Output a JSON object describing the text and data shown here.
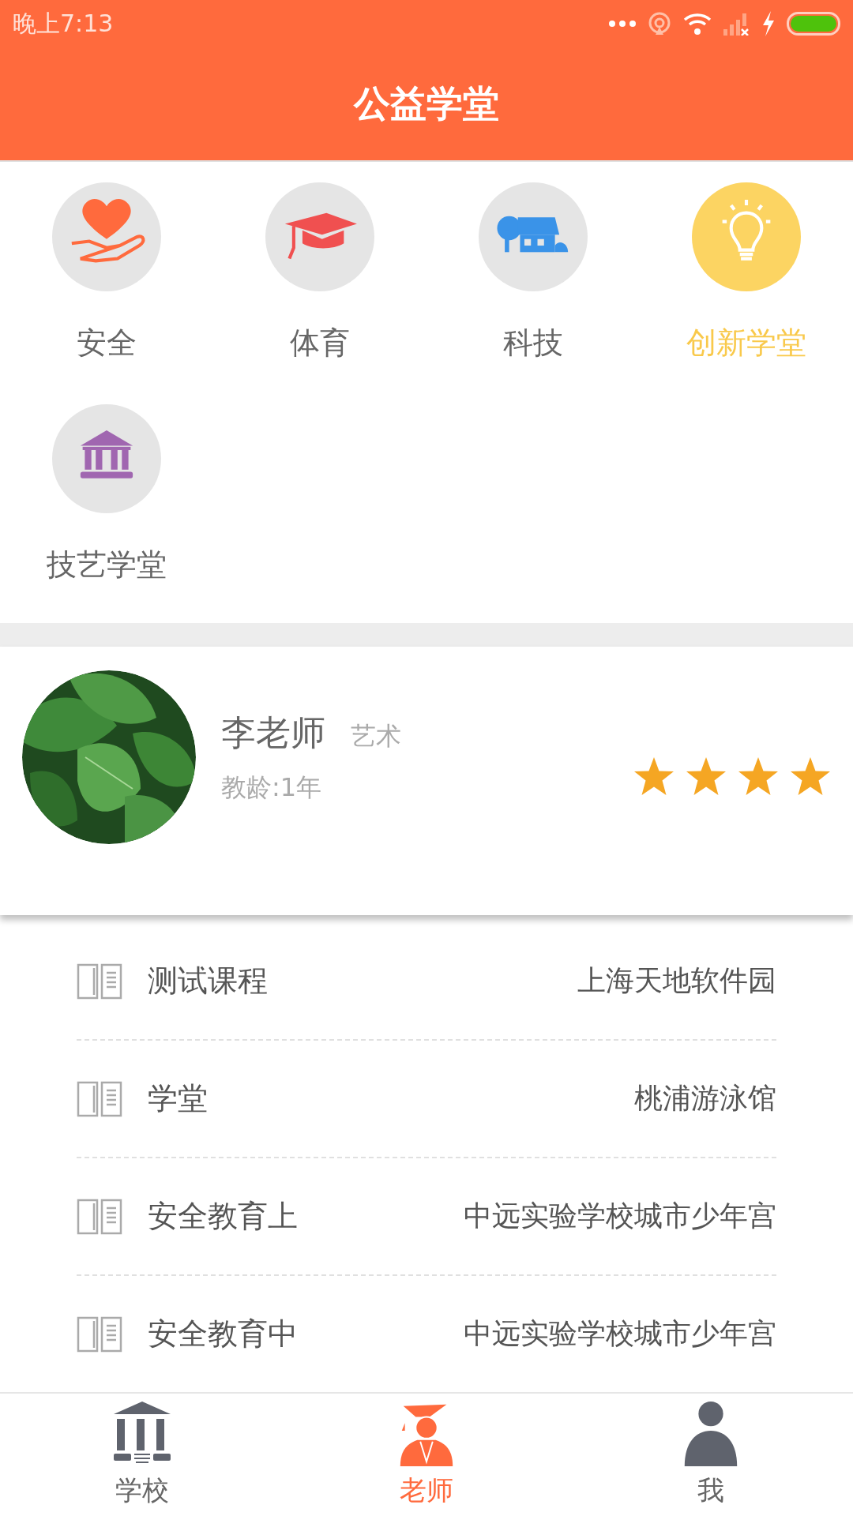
{
  "status_bar": {
    "time": "晚上7:13"
  },
  "header": {
    "title": "公益学堂"
  },
  "categories": [
    {
      "kind": "heart",
      "label": "安全",
      "selected": false
    },
    {
      "kind": "cap",
      "label": "体育",
      "selected": false
    },
    {
      "kind": "house",
      "label": "科技",
      "selected": false
    },
    {
      "kind": "bulb",
      "label": "创新学堂",
      "selected": true
    },
    {
      "kind": "museum",
      "label": "技艺学堂",
      "selected": false
    }
  ],
  "teacher": {
    "name": "李老师",
    "subject": "艺术",
    "experience": "教龄:1年",
    "stars": 4
  },
  "courses": [
    {
      "title": "测试课程",
      "location": "上海天地软件园"
    },
    {
      "title": "学堂",
      "location": "桃浦游泳馆"
    },
    {
      "title": "安全教育上",
      "location": "中远实验学校城市少年宫"
    },
    {
      "title": "安全教育中",
      "location": "中远实验学校城市少年宫"
    }
  ],
  "tab_bar": [
    {
      "kind": "school",
      "label": "学校",
      "selected": false
    },
    {
      "kind": "teacher",
      "label": "老师",
      "selected": true
    },
    {
      "kind": "me",
      "label": "我",
      "selected": false
    }
  ]
}
